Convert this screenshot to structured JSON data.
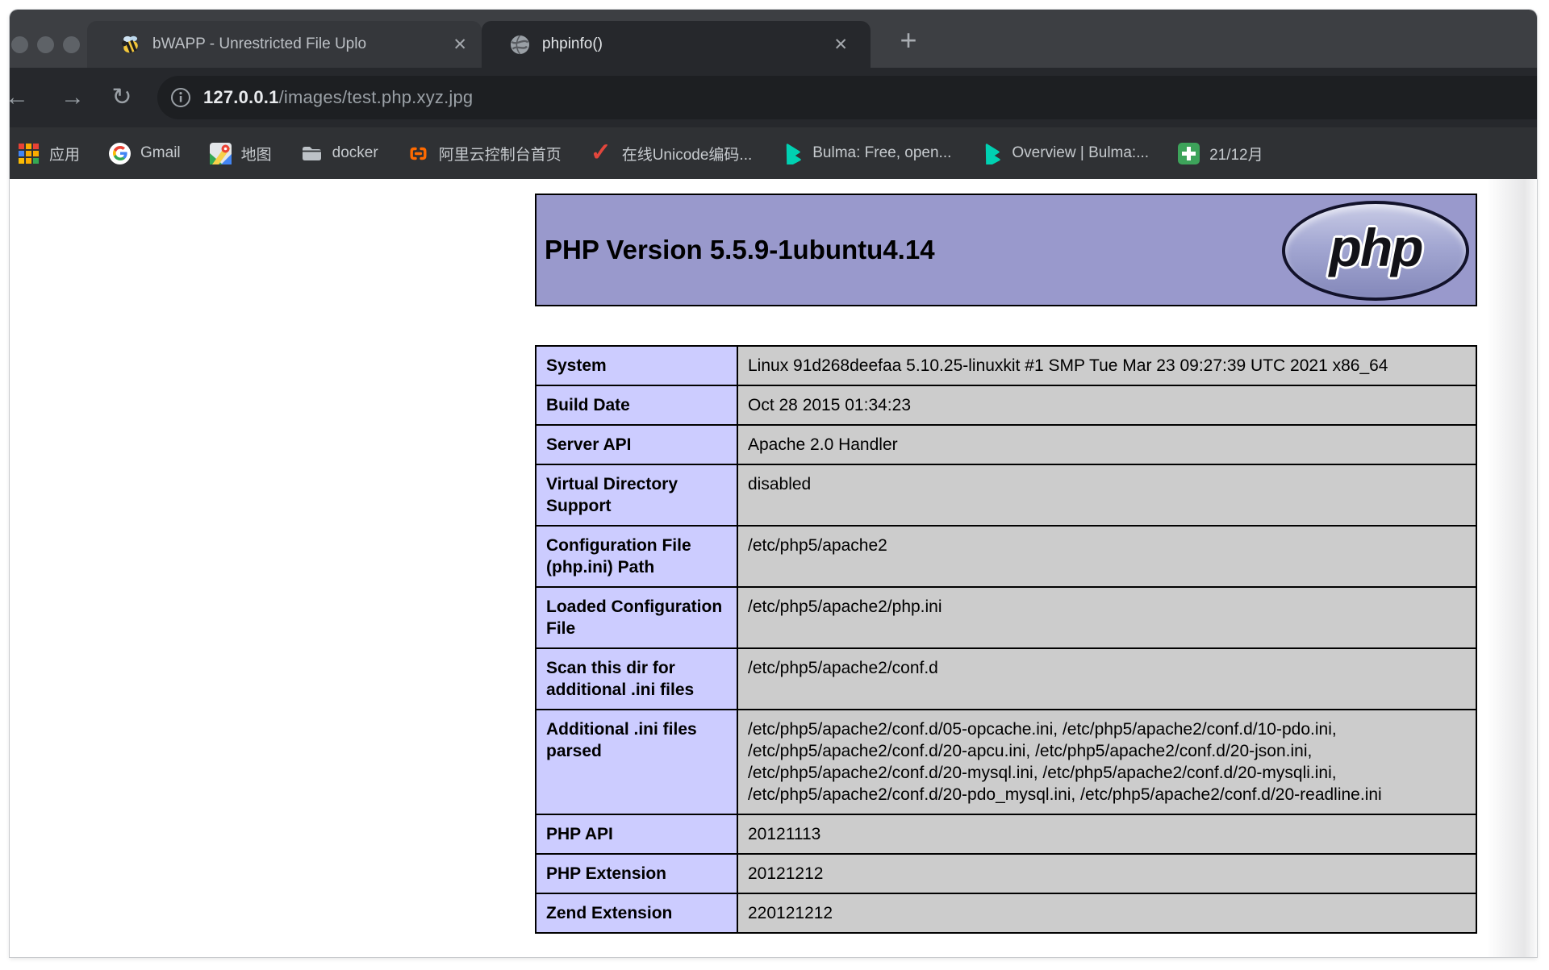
{
  "browser": {
    "tabs": [
      {
        "title": "bWAPP - Unrestricted File Uplo",
        "favicon": "bee"
      },
      {
        "title": "phpinfo()",
        "favicon": "globe"
      }
    ],
    "icons": {
      "back": "←",
      "forward": "→",
      "reload": "↻",
      "new_tab": "+",
      "close_tab": "✕"
    },
    "address_bar": {
      "host": "127.0.0.1",
      "path": "/images/test.php.xyz.jpg"
    },
    "bookmarks": [
      {
        "label": "应用",
        "icon": "apps-grid"
      },
      {
        "label": "Gmail",
        "icon": "google-g"
      },
      {
        "label": "地图",
        "icon": "google-maps"
      },
      {
        "label": "docker",
        "icon": "folder"
      },
      {
        "label": "阿里云控制台首页",
        "icon": "aliyun"
      },
      {
        "label": "在线Unicode编码...",
        "icon": "red-check"
      },
      {
        "label": "Bulma: Free, open...",
        "icon": "bulma"
      },
      {
        "label": "Overview | Bulma:...",
        "icon": "bulma"
      },
      {
        "label": "21/12月",
        "icon": "green-cross"
      }
    ]
  },
  "page": {
    "header": {
      "title": "PHP Version 5.5.9-1ubuntu4.14",
      "logo_text": "php"
    },
    "info_table": {
      "rows": [
        {
          "label": "System",
          "value": "Linux 91d268deefaa 5.10.25-linuxkit #1 SMP Tue Mar 23 09:27:39 UTC 2021 x86_64"
        },
        {
          "label": "Build Date",
          "value": "Oct 28 2015 01:34:23"
        },
        {
          "label": "Server API",
          "value": "Apache 2.0 Handler"
        },
        {
          "label": "Virtual Directory Support",
          "value": "disabled"
        },
        {
          "label": "Configuration File (php.ini) Path",
          "value": "/etc/php5/apache2"
        },
        {
          "label": "Loaded Configuration File",
          "value": "/etc/php5/apache2/php.ini"
        },
        {
          "label": "Scan this dir for additional .ini files",
          "value": "/etc/php5/apache2/conf.d"
        },
        {
          "label": "Additional .ini files parsed",
          "value": "/etc/php5/apache2/conf.d/05-opcache.ini, /etc/php5/apache2/conf.d/10-pdo.ini, /etc/php5/apache2/conf.d/20-apcu.ini, /etc/php5/apache2/conf.d/20-json.ini, /etc/php5/apache2/conf.d/20-mysql.ini, /etc/php5/apache2/conf.d/20-mysqli.ini, /etc/php5/apache2/conf.d/20-pdo_mysql.ini, /etc/php5/apache2/conf.d/20-readline.ini"
        },
        {
          "label": "PHP API",
          "value": "20121113"
        },
        {
          "label": "PHP Extension",
          "value": "20121212"
        },
        {
          "label": "Zend Extension",
          "value": "220121212"
        }
      ]
    },
    "colors": {
      "header_bg": "#9999cc",
      "label_cell_bg": "#ccccff",
      "value_cell_bg": "#cccccc"
    }
  },
  "brand_colors": {
    "aliyun_orange": "#FF6A00",
    "bulma_teal": "#00D1B2",
    "check_red": "#E2463C",
    "sheet_green": "#3DA35A"
  }
}
